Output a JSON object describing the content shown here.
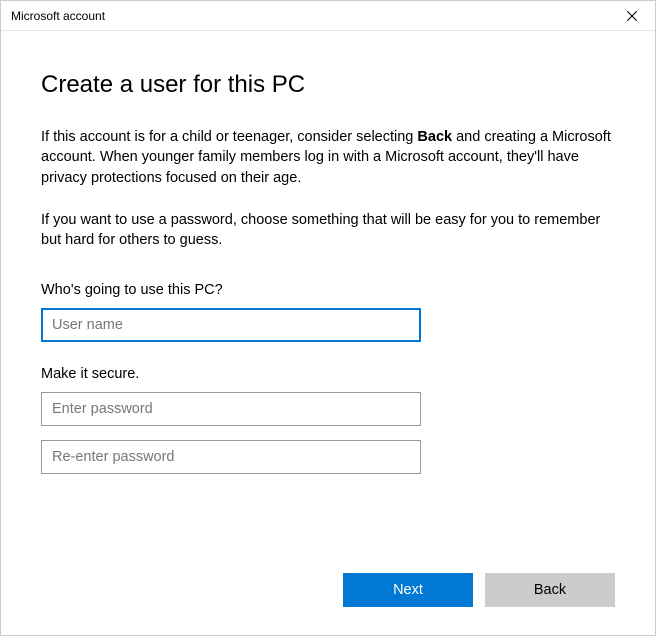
{
  "titlebar": {
    "title": "Microsoft account"
  },
  "main": {
    "heading": "Create a user for this PC",
    "para1_pre": "If this account is for a child or teenager, consider selecting ",
    "para1_bold": "Back",
    "para1_post": " and creating a Microsoft account. When younger family members log in with a Microsoft account, they'll have privacy protections focused on their age.",
    "para2": "If you want to use a password, choose something that will be easy for you to remember but hard for others to guess.",
    "section1_label": "Who's going to use this PC?",
    "username_placeholder": "User name",
    "section2_label": "Make it secure.",
    "password_placeholder": "Enter password",
    "password2_placeholder": "Re-enter password"
  },
  "buttons": {
    "next": "Next",
    "back": "Back"
  }
}
